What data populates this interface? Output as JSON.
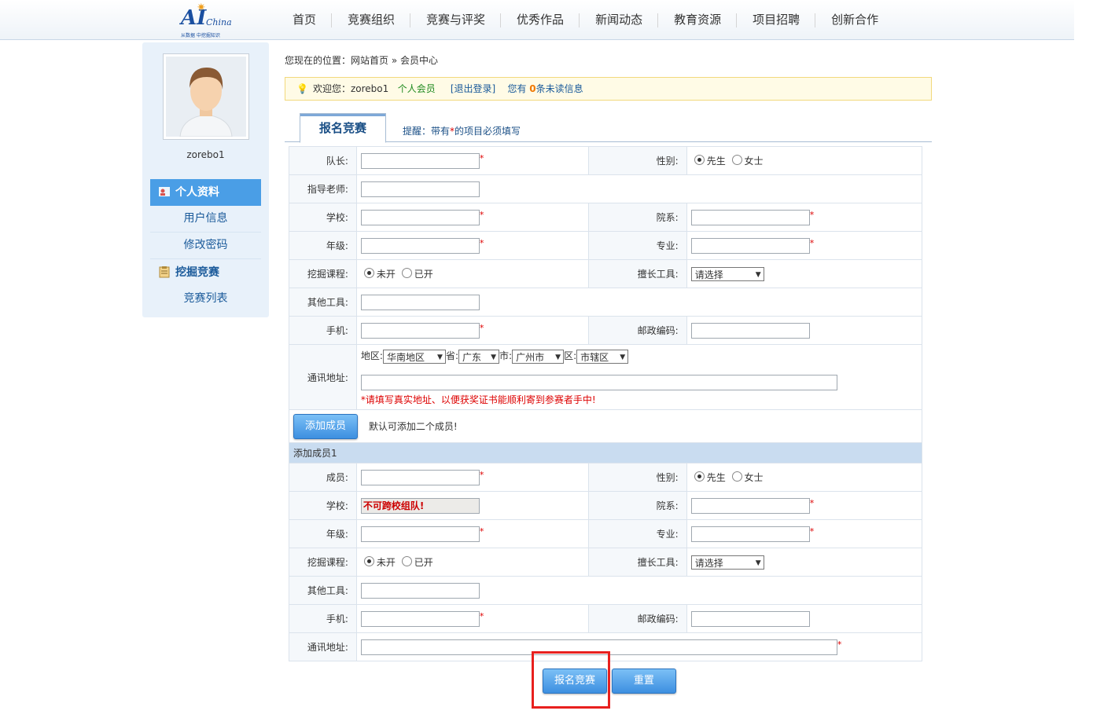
{
  "header": {
    "logo": {
      "text": "AI",
      "china": "China",
      "sub": "从数据 中挖掘知识"
    },
    "nav": [
      "首页",
      "竞赛组织",
      "竞赛与评奖",
      "优秀作品",
      "新闻动态",
      "教育资源",
      "项目招聘",
      "创新合作"
    ]
  },
  "sidebar": {
    "username": "zorebo1",
    "section1": "个人资料",
    "items1": [
      "用户信息",
      "修改密码"
    ],
    "section2": "挖掘竞赛",
    "items2": [
      "竞赛列表"
    ]
  },
  "breadcrumb": {
    "prefix": "您现在的位置：",
    "home": "网站首页",
    "sep": "»",
    "current": "会员中心"
  },
  "welcome": {
    "greeting": "欢迎您：",
    "user": "zorebo1",
    "role": "个人会员",
    "logout": "[退出登录]",
    "msg_prefix": "您有",
    "count": "0",
    "msg_suffix": "条未读信息"
  },
  "tab": {
    "label": "报名竞赛",
    "tip_prefix": "提醒：带有",
    "tip_star": "*",
    "tip_suffix": "的项目必须填写"
  },
  "form": {
    "leader": "队长:",
    "gender": "性别:",
    "male": "先生",
    "female": "女士",
    "advisor": "指导老师:",
    "school": "学校:",
    "dept": "院系:",
    "grade": "年级:",
    "major": "专业:",
    "course": "挖掘课程:",
    "not_open": "未开",
    "opened": "已开",
    "tools": "擅长工具:",
    "select_default": "请选择",
    "other_tools": "其他工具:",
    "phone": "手机:",
    "zip": "邮政编码:",
    "address": "通讯地址:",
    "region_label": "地区:",
    "region": "华南地区",
    "province_label": "省:",
    "province": "广东",
    "city_label": "市:",
    "city": "广州市",
    "district_label": "区:",
    "district": "市辖区",
    "address_hint": "*请填写真实地址、以便获奖证书能顺利寄到参赛者手中!",
    "add_member_btn": "添加成员",
    "add_member_note": "默认可添加二个成员!",
    "member_section": "添加成员1",
    "member": "成员:",
    "member_gender": "性别:",
    "member_school_value": "不可跨校组队!"
  },
  "buttons": {
    "submit": "报名竞赛",
    "reset": "重置"
  }
}
